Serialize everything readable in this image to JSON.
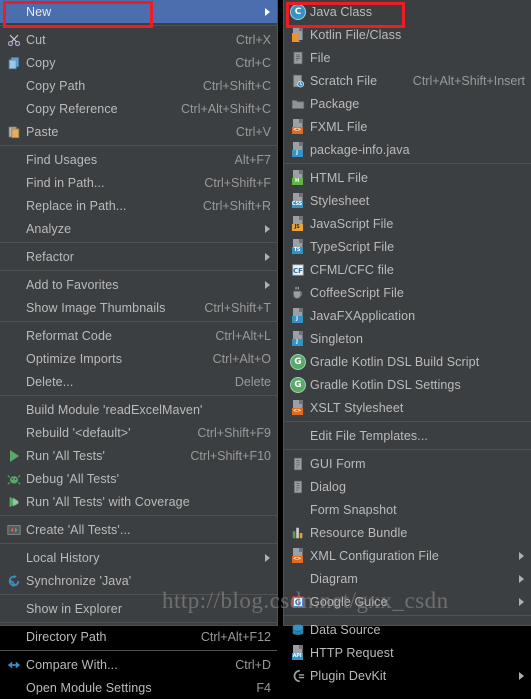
{
  "context_menu": {
    "items": [
      {
        "label": "New",
        "shortcut": "",
        "icon": "none",
        "submenu": true,
        "selected": true
      },
      {
        "sep": true
      },
      {
        "label": "Cut",
        "shortcut": "Ctrl+X",
        "icon": "scissors-icon",
        "submenu": false
      },
      {
        "label": "Copy",
        "shortcut": "Ctrl+C",
        "icon": "copy-icon",
        "submenu": false
      },
      {
        "label": "Copy Path",
        "shortcut": "Ctrl+Shift+C",
        "icon": "none",
        "submenu": false
      },
      {
        "label": "Copy Reference",
        "shortcut": "Ctrl+Alt+Shift+C",
        "icon": "none",
        "submenu": false
      },
      {
        "label": "Paste",
        "shortcut": "Ctrl+V",
        "icon": "paste-icon",
        "submenu": false
      },
      {
        "sep": true
      },
      {
        "label": "Find Usages",
        "shortcut": "Alt+F7",
        "icon": "none",
        "submenu": false
      },
      {
        "label": "Find in Path...",
        "shortcut": "Ctrl+Shift+F",
        "icon": "none",
        "submenu": false
      },
      {
        "label": "Replace in Path...",
        "shortcut": "Ctrl+Shift+R",
        "icon": "none",
        "submenu": false
      },
      {
        "label": "Analyze",
        "shortcut": "",
        "icon": "none",
        "submenu": true
      },
      {
        "sep": true
      },
      {
        "label": "Refactor",
        "shortcut": "",
        "icon": "none",
        "submenu": true
      },
      {
        "sep": true
      },
      {
        "label": "Add to Favorites",
        "shortcut": "",
        "icon": "none",
        "submenu": true
      },
      {
        "label": "Show Image Thumbnails",
        "shortcut": "Ctrl+Shift+T",
        "icon": "none",
        "submenu": false
      },
      {
        "sep": true
      },
      {
        "label": "Reformat Code",
        "shortcut": "Ctrl+Alt+L",
        "icon": "none",
        "submenu": false
      },
      {
        "label": "Optimize Imports",
        "shortcut": "Ctrl+Alt+O",
        "icon": "none",
        "submenu": false
      },
      {
        "label": "Delete...",
        "shortcut": "Delete",
        "icon": "none",
        "submenu": false
      },
      {
        "sep": true
      },
      {
        "label": "Build Module 'readExcelMaven'",
        "shortcut": "",
        "icon": "none",
        "submenu": false
      },
      {
        "label": "Rebuild '<default>'",
        "shortcut": "Ctrl+Shift+F9",
        "icon": "none",
        "submenu": false
      },
      {
        "label": "Run 'All Tests'",
        "shortcut": "Ctrl+Shift+F10",
        "icon": "run-icon",
        "submenu": false
      },
      {
        "label": "Debug 'All Tests'",
        "shortcut": "",
        "icon": "debug-icon",
        "submenu": false
      },
      {
        "label": "Run 'All Tests' with Coverage",
        "shortcut": "",
        "icon": "coverage-icon",
        "submenu": false
      },
      {
        "sep": true
      },
      {
        "label": "Create 'All Tests'...",
        "shortcut": "",
        "icon": "create-config-icon",
        "submenu": false
      },
      {
        "sep": true
      },
      {
        "label": "Local History",
        "shortcut": "",
        "icon": "none",
        "submenu": true
      },
      {
        "label": "Synchronize 'Java'",
        "shortcut": "",
        "icon": "sync-icon",
        "submenu": false
      },
      {
        "sep": true
      },
      {
        "label": "Show in Explorer",
        "shortcut": "",
        "icon": "none",
        "submenu": false
      },
      {
        "sep": true
      },
      {
        "label": "Directory Path",
        "shortcut": "Ctrl+Alt+F12",
        "icon": "none",
        "submenu": false
      },
      {
        "sep": true
      },
      {
        "label": "Compare With...",
        "shortcut": "Ctrl+D",
        "icon": "compare-icon",
        "submenu": false
      },
      {
        "label": "Open Module Settings",
        "shortcut": "F4",
        "icon": "none",
        "submenu": false
      }
    ]
  },
  "new_submenu": {
    "items": [
      {
        "label": "Java Class",
        "shortcut": "",
        "icon": "java-class-icon",
        "submenu": false,
        "highlighted": true
      },
      {
        "label": "Kotlin File/Class",
        "shortcut": "",
        "icon": "kotlin-file-icon",
        "submenu": false
      },
      {
        "label": "File",
        "shortcut": "",
        "icon": "file-icon",
        "submenu": false
      },
      {
        "label": "Scratch File",
        "shortcut": "Ctrl+Alt+Shift+Insert",
        "icon": "scratch-file-icon",
        "submenu": false
      },
      {
        "label": "Package",
        "shortcut": "",
        "icon": "package-icon",
        "submenu": false
      },
      {
        "label": "FXML File",
        "shortcut": "",
        "icon": "fxml-file-icon",
        "submenu": false
      },
      {
        "label": "package-info.java",
        "shortcut": "",
        "icon": "package-info-icon",
        "submenu": false
      },
      {
        "sep": true
      },
      {
        "label": "HTML File",
        "shortcut": "",
        "icon": "html-file-icon",
        "submenu": false
      },
      {
        "label": "Stylesheet",
        "shortcut": "",
        "icon": "css-file-icon",
        "submenu": false
      },
      {
        "label": "JavaScript File",
        "shortcut": "",
        "icon": "js-file-icon",
        "submenu": false
      },
      {
        "label": "TypeScript File",
        "shortcut": "",
        "icon": "ts-file-icon",
        "submenu": false
      },
      {
        "label": "CFML/CFC file",
        "shortcut": "",
        "icon": "cfml-file-icon",
        "submenu": false
      },
      {
        "label": "CoffeeScript File",
        "shortcut": "",
        "icon": "coffeescript-file-icon",
        "submenu": false
      },
      {
        "label": "JavaFXApplication",
        "shortcut": "",
        "icon": "javafx-app-icon",
        "submenu": false
      },
      {
        "label": "Singleton",
        "shortcut": "",
        "icon": "singleton-icon",
        "submenu": false
      },
      {
        "label": "Gradle Kotlin DSL Build Script",
        "shortcut": "",
        "icon": "gradle-icon",
        "submenu": false
      },
      {
        "label": "Gradle Kotlin DSL Settings",
        "shortcut": "",
        "icon": "gradle-icon",
        "submenu": false
      },
      {
        "label": "XSLT Stylesheet",
        "shortcut": "",
        "icon": "xslt-file-icon",
        "submenu": false
      },
      {
        "sep": true
      },
      {
        "label": "Edit File Templates...",
        "shortcut": "",
        "icon": "none",
        "submenu": false
      },
      {
        "sep": true
      },
      {
        "label": "GUI Form",
        "shortcut": "",
        "icon": "gui-form-icon",
        "submenu": false
      },
      {
        "label": "Dialog",
        "shortcut": "",
        "icon": "dialog-icon",
        "submenu": false
      },
      {
        "label": "Form Snapshot",
        "shortcut": "",
        "icon": "none",
        "submenu": false
      },
      {
        "label": "Resource Bundle",
        "shortcut": "",
        "icon": "resource-bundle-icon",
        "submenu": false
      },
      {
        "label": "XML Configuration File",
        "shortcut": "",
        "icon": "xml-config-icon",
        "submenu": true
      },
      {
        "label": "Diagram",
        "shortcut": "",
        "icon": "none",
        "submenu": true
      },
      {
        "label": "Google Guice",
        "shortcut": "",
        "icon": "google-guice-icon",
        "submenu": true
      },
      {
        "sep": true
      },
      {
        "label": "Data Source",
        "shortcut": "",
        "icon": "data-source-icon",
        "submenu": false
      },
      {
        "label": "HTTP Request",
        "shortcut": "",
        "icon": "http-request-icon",
        "submenu": false
      },
      {
        "label": "Plugin DevKit",
        "shortcut": "",
        "icon": "plugin-devkit-icon",
        "submenu": true
      }
    ]
  },
  "annotations": {
    "highlight_color": "#ee1c25",
    "watermark": "http://blog.csdn.net/gxx_csdn"
  },
  "theme": {
    "menu_background": "#3c3f41",
    "selection_background": "#4b6eaf",
    "text_color": "#bbbbbb",
    "shortcut_color": "#999999",
    "separator_color": "#4e5254"
  }
}
